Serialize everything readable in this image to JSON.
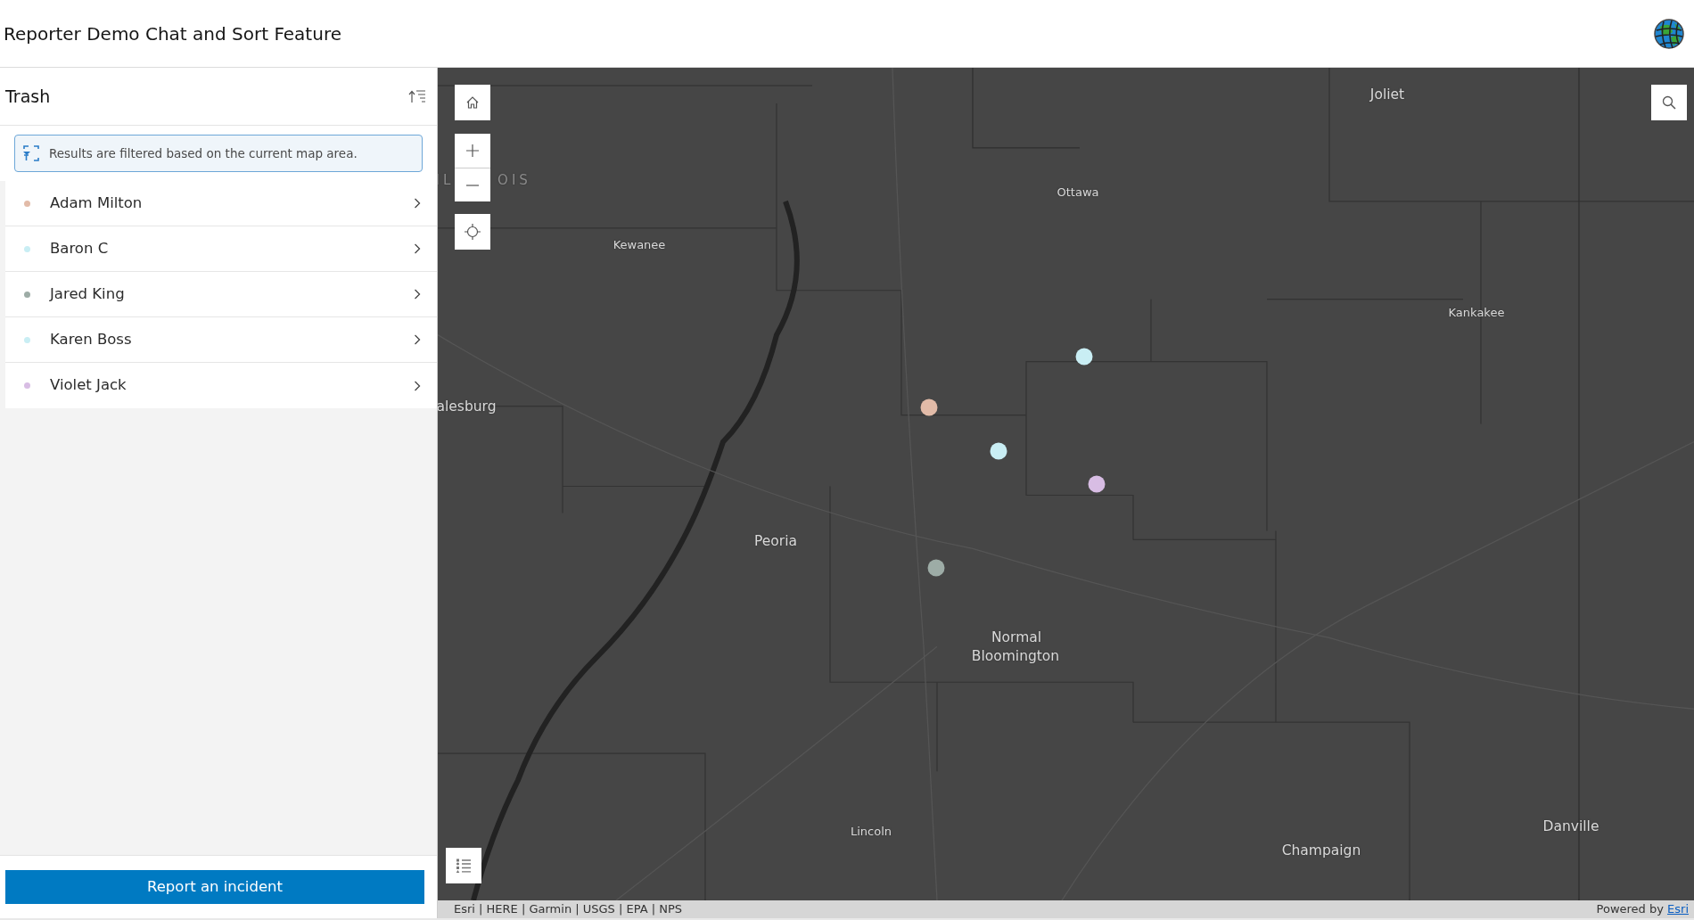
{
  "header": {
    "title": "Reporter Demo Chat and Sort Feature"
  },
  "panel": {
    "title": "Trash",
    "notice": "Results are filtered based on the current map area.",
    "items": [
      {
        "name": "Adam Milton",
        "color": "#e2bba8"
      },
      {
        "name": "Baron C",
        "color": "#c9eef4"
      },
      {
        "name": "Jared King",
        "color": "#9daca6"
      },
      {
        "name": "Karen Boss",
        "color": "#c9eef4"
      },
      {
        "name": "Violet Jack",
        "color": "#d8bde4"
      }
    ],
    "button": "Report an incident"
  },
  "map": {
    "labels": [
      {
        "text": "Joliet",
        "kind": "city"
      },
      {
        "text": "Ottawa",
        "kind": "town"
      },
      {
        "text": "Kewanee",
        "kind": "town"
      },
      {
        "text": "Kankakee",
        "kind": "town"
      },
      {
        "text": "alesburg",
        "kind": "city"
      },
      {
        "text": "Peoria",
        "kind": "city"
      },
      {
        "text": "Normal",
        "kind": "city"
      },
      {
        "text": "Bloomington",
        "kind": "city"
      },
      {
        "text": "Lincoln",
        "kind": "town"
      },
      {
        "text": "Champaign",
        "kind": "city"
      },
      {
        "text": "Danville",
        "kind": "city"
      },
      {
        "text": "IL",
        "kind": "state"
      },
      {
        "text": "OIS",
        "kind": "state"
      }
    ],
    "points": [
      {
        "color": "#e2bba8"
      },
      {
        "color": "#c9eef4"
      },
      {
        "color": "#c9eef4"
      },
      {
        "color": "#d8bde4"
      },
      {
        "color": "#9daca6"
      }
    ],
    "attribution": "Esri | HERE | Garmin | USGS | EPA | NPS",
    "powered_by": "Powered by",
    "powered_link": "Esri"
  }
}
